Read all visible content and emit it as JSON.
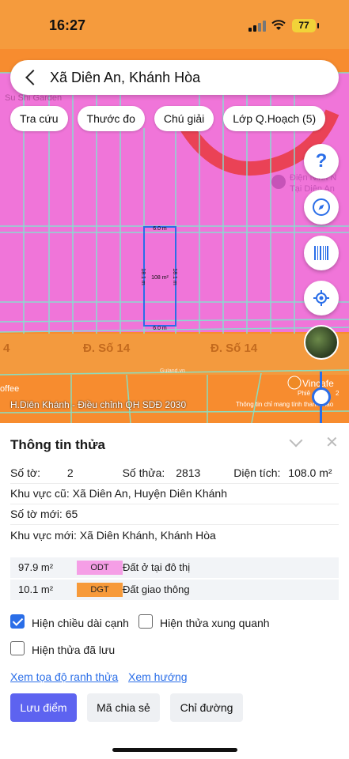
{
  "status": {
    "time": "16:27",
    "battery": "77"
  },
  "search": {
    "text": "Xã Diên An, Khánh Hòa"
  },
  "chips": [
    "Tra cứu",
    "Thước đo",
    "Chú giải",
    "Lớp Q.Hoạch (5)"
  ],
  "map": {
    "labels": {
      "garden": "Su Shi Garden",
      "road_left": "4",
      "road_mid": "Đ. Số 14",
      "road_right": "Đ. Số 14",
      "coffee": "offee",
      "place_right_1": "Điện Ninh N",
      "place_right_2": "Tại Diên An",
      "vin": "Vincafe",
      "phien": "Phiê",
      "phien_num": "2",
      "watermark": "Guland.vn"
    },
    "plot": {
      "top_len": "6.0 m",
      "bottom_len": "6.0 m",
      "left_len": "18.1 m",
      "right_len": "18.1 m",
      "area": "108 m²"
    },
    "caption": "H.Diên Khánh - Điều chỉnh QH SDĐ 2030",
    "caption_right": "Thông tin chỉ mang tính tham khảo",
    "colors": {
      "residential": "#f075d9",
      "road": "#f78c2f",
      "lines": "#7fe6cf",
      "plot_border": "#2a6ee8"
    }
  },
  "fabs": {
    "help": "?",
    "compass": "compass-icon",
    "barcode": "barcode-icon",
    "locate": "locate-icon"
  },
  "panel": {
    "title": "Thông tin thửa",
    "so_to_label": "Số tờ:",
    "so_to_value": "2",
    "so_thua_label": "Số thửa:",
    "so_thua_value": "2813",
    "dien_tich_label": "Diện tích:",
    "dien_tich_value": "108.0 m²",
    "kv_cu_label": "Khu vực cũ:",
    "kv_cu_value": "Xã Diên An, Huyện Diên Khánh",
    "so_to_moi_label": "Số tờ mới:",
    "so_to_moi_value": "65",
    "kv_moi_label": "Khu vực mới:",
    "kv_moi_value": "Xã Diên Khánh, Khánh Hòa",
    "land_uses": [
      {
        "area": "97.9 m²",
        "code": "ODT",
        "desc": "Đất ở tại đô thị",
        "color": "#f59ee6"
      },
      {
        "area": "10.1 m²",
        "code": "DGT",
        "desc": "Đất giao thông",
        "color": "#f79a3a"
      }
    ],
    "checkboxes": {
      "show_edges": "Hiện chiều dài cạnh",
      "show_surrounding": "Hiện thửa xung quanh",
      "show_saved": "Hiện thửa đã lưu"
    },
    "links": {
      "coords": "Xem tọa độ ranh thửa",
      "direction": "Xem hướng"
    },
    "buttons": {
      "save": "Lưu điểm",
      "share": "Mã chia sẻ",
      "route": "Chỉ đường"
    }
  }
}
